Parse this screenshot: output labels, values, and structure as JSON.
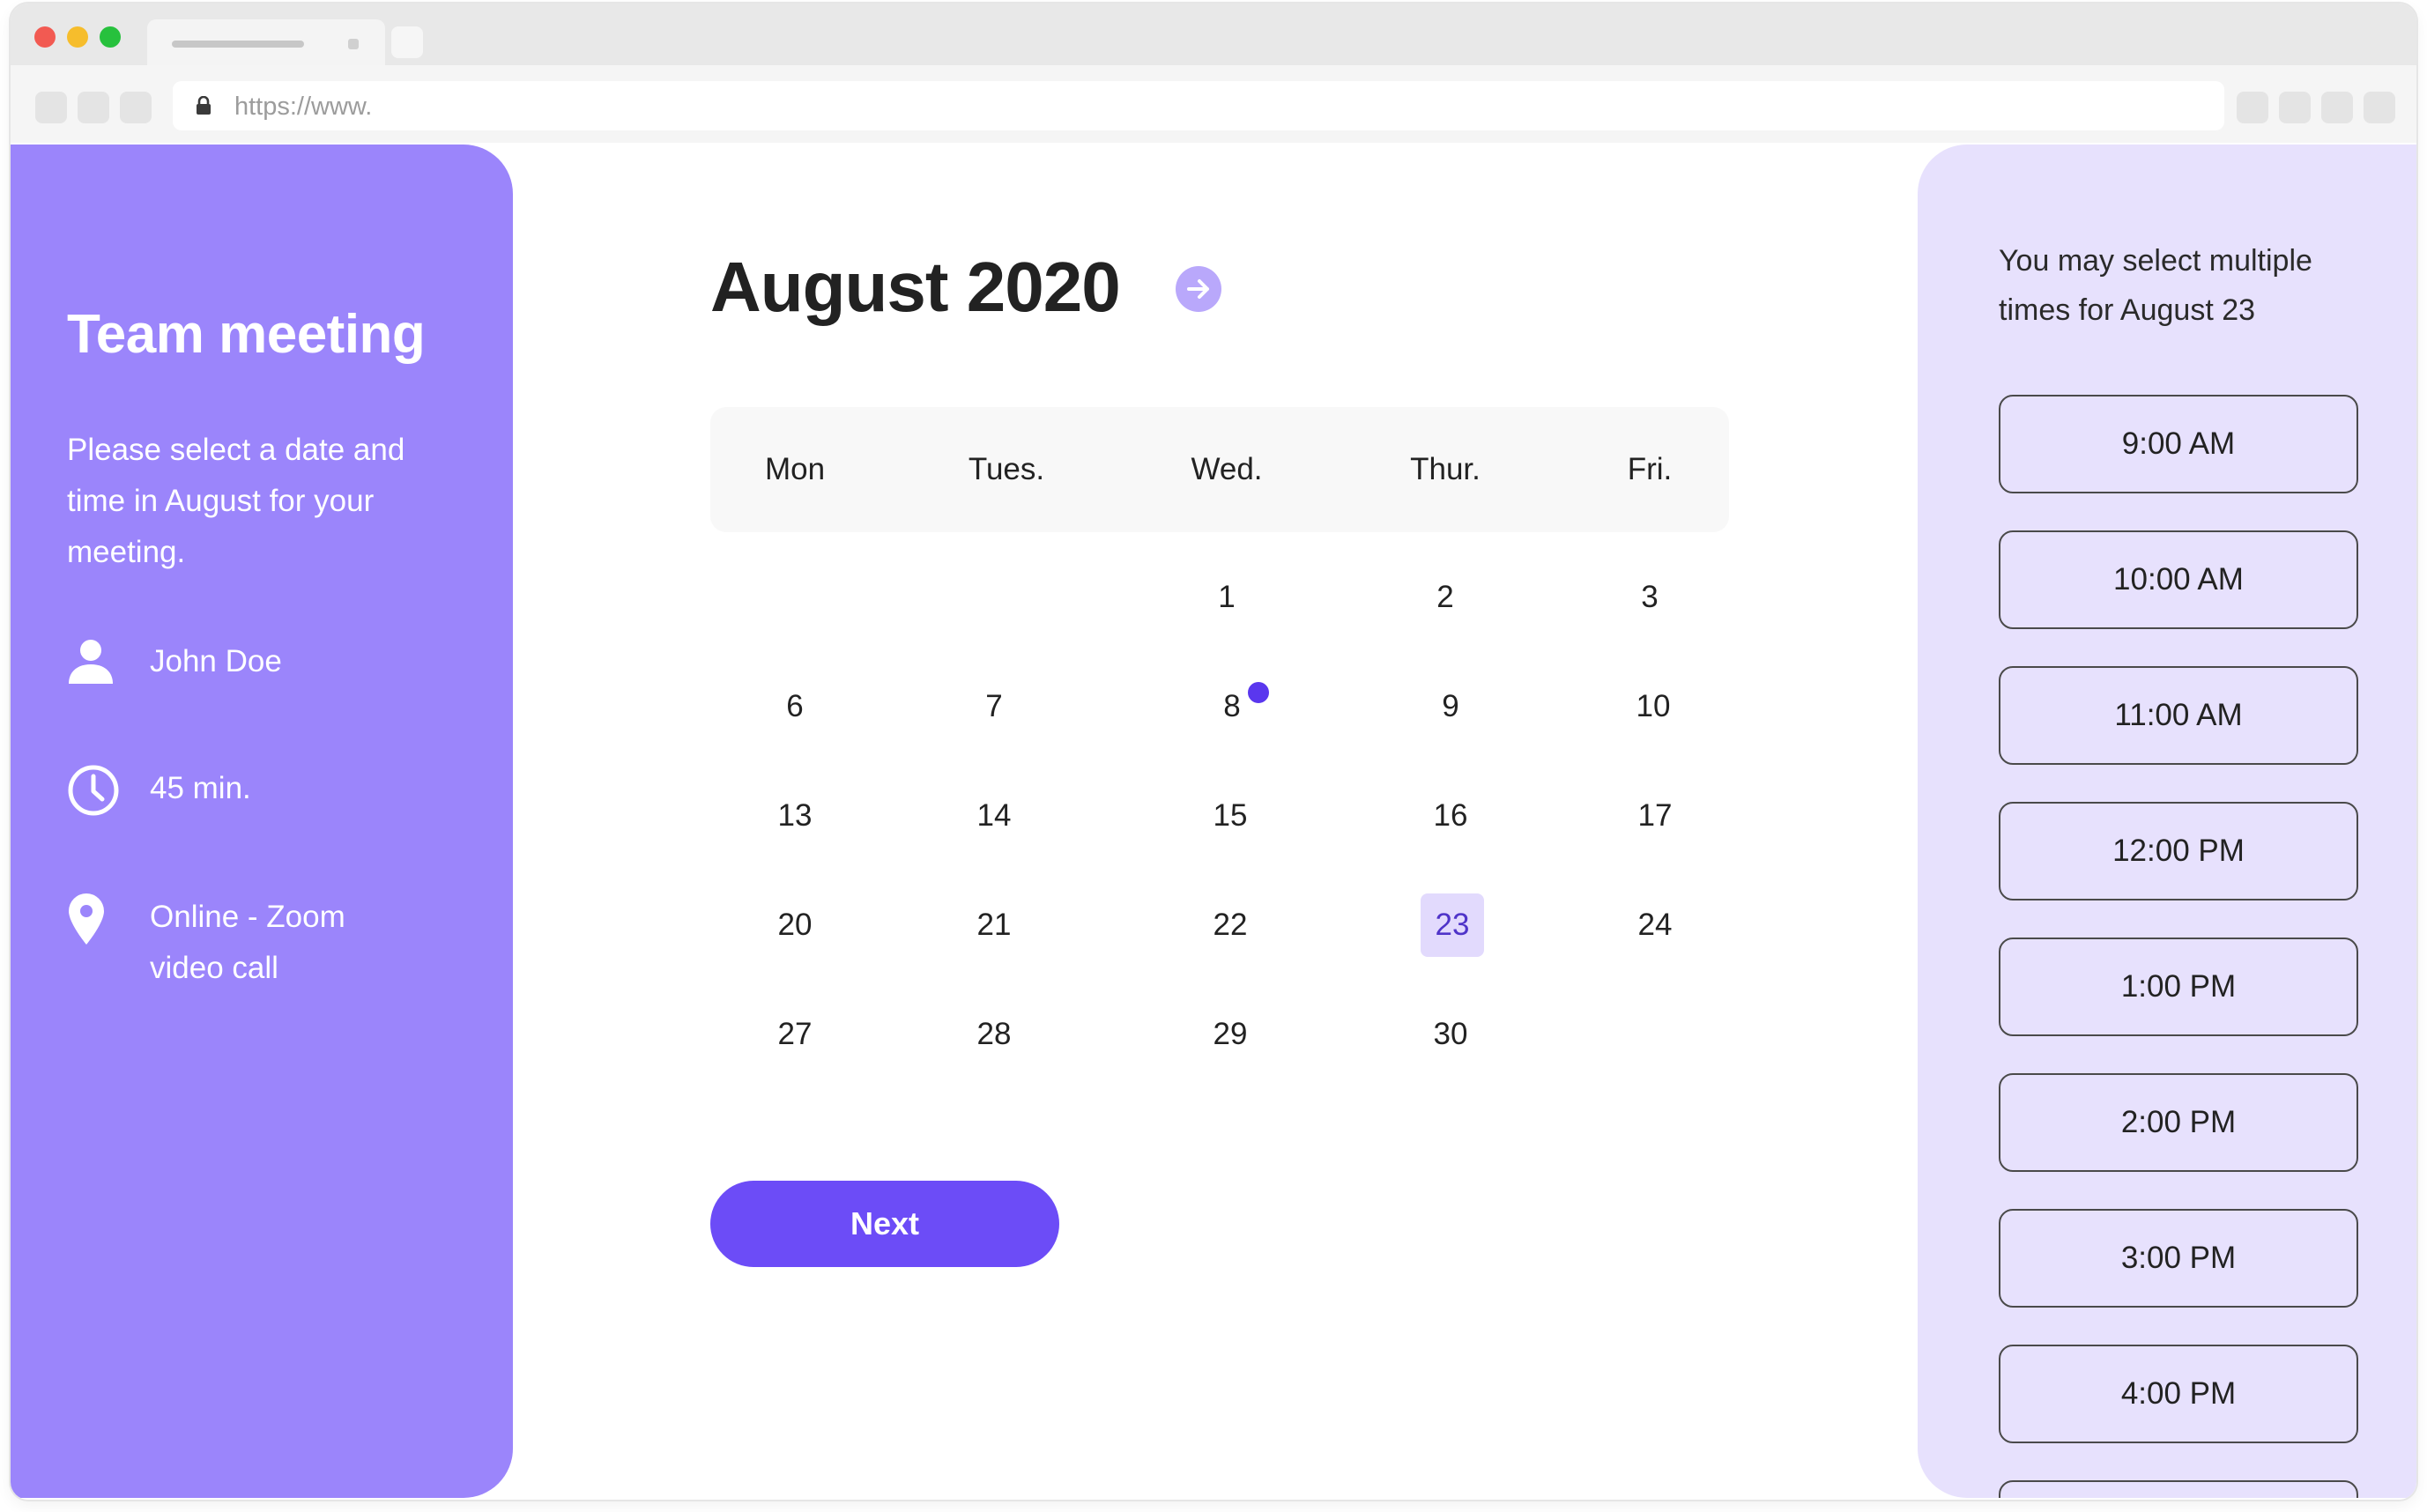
{
  "browser": {
    "url": "https://www."
  },
  "sidebar": {
    "title": "Team meeting",
    "description": "Please select a date and time in August for your meeting.",
    "host": "John Doe",
    "duration": "45 min.",
    "location": "Online - Zoom video call",
    "accent_color": "#9b85fb"
  },
  "calendar": {
    "month_label": "August 2020",
    "weekdays": [
      "Mon",
      "Tues.",
      "Wed.",
      "Thur.",
      "Fri."
    ],
    "days": {
      "d1": "1",
      "d2": "2",
      "d3": "3",
      "d6": "6",
      "d7": "7",
      "d8": "8",
      "d9": "9",
      "d10": "10",
      "d13": "13",
      "d14": "14",
      "d15": "15",
      "d16": "16",
      "d17": "17",
      "d20": "20",
      "d21": "21",
      "d22": "22",
      "d23": "23",
      "d24": "24",
      "d27": "27",
      "d28": "28",
      "d29": "29",
      "d30": "30"
    },
    "selected_day": "23",
    "event_day": "8",
    "next_label": "Next",
    "button_color": "#6c4cf7"
  },
  "times": {
    "note": "You may select multiple times for August 23",
    "slots": [
      "9:00 AM",
      "10:00 AM",
      "11:00 AM",
      "12:00 PM",
      "1:00 PM",
      "2:00 PM",
      "3:00 PM",
      "4:00 PM"
    ]
  }
}
